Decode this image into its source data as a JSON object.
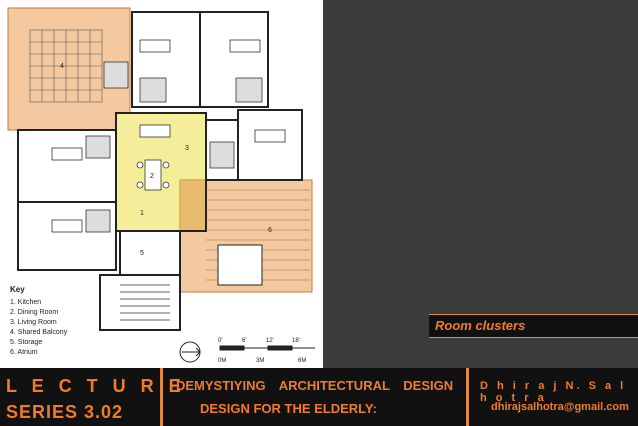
{
  "slide": {
    "caption": "Room clusters",
    "footer": {
      "lecture_line1": "L E C T U R E",
      "lecture_line2": "SERIES 3.02",
      "title_line1": "DEMYSTIYING ARCHITECTURAL DESIGN",
      "title_line2": "DESIGN FOR THE ELDERLY:",
      "author": "D h i r a j   N. S a l h o t r a",
      "email": "dhirajsalhotra@gmail.com"
    }
  },
  "plan": {
    "key_title": "Key",
    "key_items": [
      "1. Kitchen",
      "2. Dining Room",
      "3. Living Room",
      "4. Shared Balcony",
      "5. Storage",
      "6. Atrium"
    ],
    "scale_labels": [
      "0'",
      "6'",
      "12'",
      "18'",
      "0M",
      "3M",
      "6M"
    ],
    "room_numbers": [
      "4",
      "2",
      "3",
      "1",
      "5",
      "6"
    ]
  },
  "colors": {
    "accent": "#f07c2a",
    "highlight_peach": "#f5c9a0",
    "highlight_yellow": "#f4ee9a",
    "panel_dark": "#3b3b3b",
    "footer_bg": "#111111"
  }
}
